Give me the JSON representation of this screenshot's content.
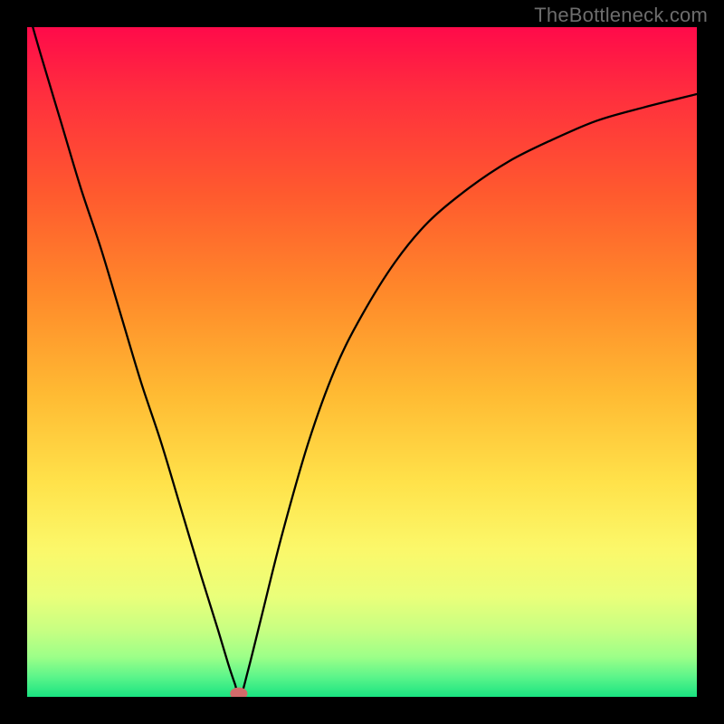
{
  "watermark": "TheBottleneck.com",
  "chart_data": {
    "type": "line",
    "title": "",
    "xlabel": "",
    "ylabel": "",
    "xlim": [
      0,
      100
    ],
    "ylim": [
      0,
      100
    ],
    "grid": false,
    "legend": false,
    "series": [
      {
        "name": "curve",
        "x": [
          0,
          2,
          5,
          8,
          11,
          14,
          17,
          20,
          23,
          26,
          28.5,
          30,
          31,
          31.8,
          33,
          35,
          38,
          42,
          46,
          50,
          55,
          60,
          66,
          72,
          78,
          85,
          92,
          100
        ],
        "y": [
          103,
          96,
          86,
          76,
          67,
          57,
          47,
          38,
          28,
          18,
          10,
          5,
          2,
          0,
          4,
          12,
          24,
          38,
          49,
          57,
          65,
          71,
          76,
          80,
          83,
          86,
          88,
          90
        ]
      }
    ],
    "marker": {
      "x": 31.6,
      "y": 0.5,
      "rx": 1.3,
      "ry": 0.9,
      "color": "#d36a6a"
    },
    "background_gradient": {
      "stops": [
        {
          "pos": 0.0,
          "color": "#ff0a4a"
        },
        {
          "pos": 0.1,
          "color": "#ff2e3e"
        },
        {
          "pos": 0.25,
          "color": "#ff5a2e"
        },
        {
          "pos": 0.4,
          "color": "#ff8a2a"
        },
        {
          "pos": 0.55,
          "color": "#ffbb33"
        },
        {
          "pos": 0.68,
          "color": "#ffe24a"
        },
        {
          "pos": 0.78,
          "color": "#fbf86a"
        },
        {
          "pos": 0.85,
          "color": "#eaff7a"
        },
        {
          "pos": 0.9,
          "color": "#c8ff82"
        },
        {
          "pos": 0.94,
          "color": "#9dff88"
        },
        {
          "pos": 0.97,
          "color": "#5cf58a"
        },
        {
          "pos": 1.0,
          "color": "#19e381"
        }
      ]
    }
  }
}
